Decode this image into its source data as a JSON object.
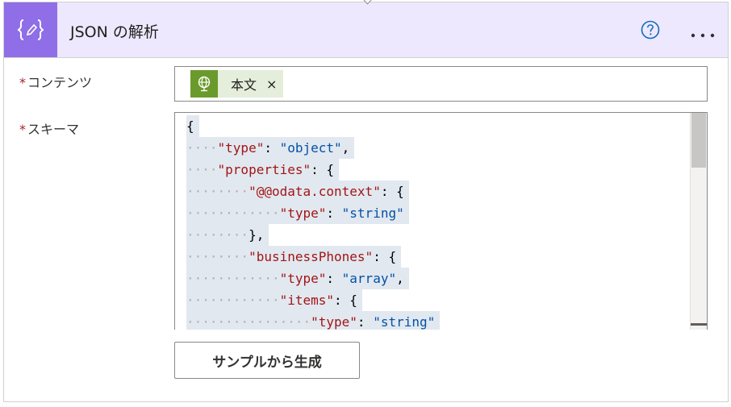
{
  "action": {
    "title": "JSON の解析",
    "icon": "json-brace-pen-icon",
    "accent_color": "#8f6ee8",
    "header_bg": "#ede8fd"
  },
  "fields": {
    "content": {
      "required_mark": "*",
      "label": "コンテンツ",
      "token": {
        "icon": "globe-icon",
        "label": "本文",
        "remove": "×",
        "color": "#6a9a2c"
      }
    },
    "schema": {
      "required_mark": "*",
      "label": "スキーマ",
      "lines": [
        {
          "indent": 0,
          "parts": [
            {
              "t": "p",
              "v": "{"
            }
          ]
        },
        {
          "indent": 1,
          "parts": [
            {
              "t": "k",
              "v": "\"type\""
            },
            {
              "t": "p",
              "v": ": "
            },
            {
              "t": "s",
              "v": "\"object\""
            },
            {
              "t": "p",
              "v": ","
            }
          ]
        },
        {
          "indent": 1,
          "parts": [
            {
              "t": "k",
              "v": "\"properties\""
            },
            {
              "t": "p",
              "v": ": {"
            }
          ]
        },
        {
          "indent": 2,
          "parts": [
            {
              "t": "k",
              "v": "\"@@odata.context\""
            },
            {
              "t": "p",
              "v": ": {"
            }
          ]
        },
        {
          "indent": 3,
          "parts": [
            {
              "t": "k",
              "v": "\"type\""
            },
            {
              "t": "p",
              "v": ": "
            },
            {
              "t": "s",
              "v": "\"string\""
            }
          ]
        },
        {
          "indent": 2,
          "parts": [
            {
              "t": "p",
              "v": "},"
            }
          ]
        },
        {
          "indent": 2,
          "parts": [
            {
              "t": "k",
              "v": "\"businessPhones\""
            },
            {
              "t": "p",
              "v": ": {"
            }
          ]
        },
        {
          "indent": 3,
          "parts": [
            {
              "t": "k",
              "v": "\"type\""
            },
            {
              "t": "p",
              "v": ": "
            },
            {
              "t": "s",
              "v": "\"array\""
            },
            {
              "t": "p",
              "v": ","
            }
          ]
        },
        {
          "indent": 3,
          "parts": [
            {
              "t": "k",
              "v": "\"items\""
            },
            {
              "t": "p",
              "v": ": {"
            }
          ]
        },
        {
          "indent": 4,
          "parts": [
            {
              "t": "k",
              "v": "\"type\""
            },
            {
              "t": "p",
              "v": ": "
            },
            {
              "t": "s",
              "v": "\"string\""
            }
          ]
        }
      ]
    }
  },
  "buttons": {
    "generate": "サンプルから生成"
  },
  "header_icons": {
    "help": "help-circle-icon",
    "more": "more-options-icon"
  }
}
